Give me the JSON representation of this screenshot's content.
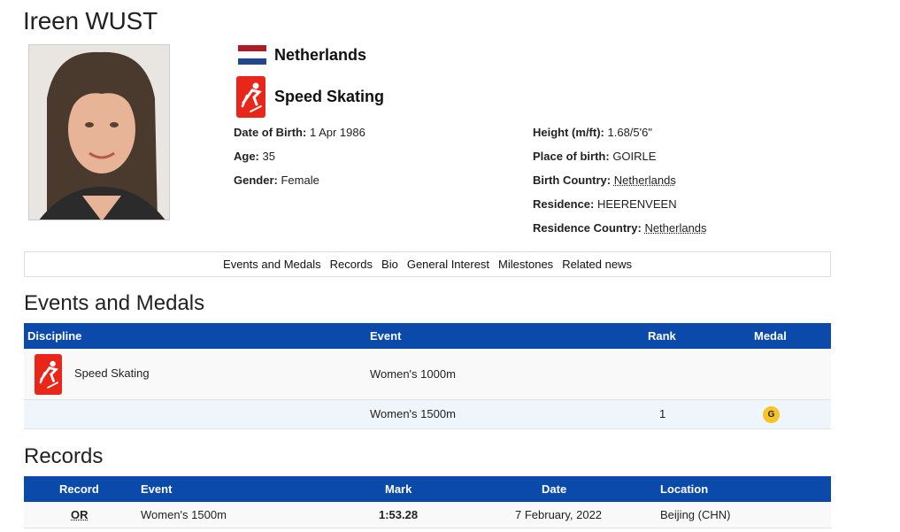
{
  "athlete": {
    "name": "Ireen WUST",
    "country": "Netherlands",
    "sport": "Speed Skating"
  },
  "flag_colors": [
    "#ae1c28",
    "#ffffff",
    "#21468b"
  ],
  "info_left": [
    {
      "label": "Date of Birth:",
      "value": "1 Apr 1986"
    },
    {
      "label": "Age:",
      "value": "35"
    },
    {
      "label": "Gender:",
      "value": "Female"
    }
  ],
  "info_right": [
    {
      "label": "Height (m/ft):",
      "value": "1.68/5'6\""
    },
    {
      "label": "Place of birth:",
      "value": "GOIRLE"
    },
    {
      "label": "Birth Country:",
      "value": "Netherlands"
    },
    {
      "label": "Residence:",
      "value": "HEERENVEEN"
    },
    {
      "label": "Residence Country:",
      "value": "Netherlands"
    }
  ],
  "nav": [
    "Events and Medals",
    "Records",
    "Bio",
    "General Interest",
    "Milestones",
    "Related news"
  ],
  "events_section": {
    "title": "Events and Medals",
    "columns": [
      "Discipline",
      "Event",
      "Rank",
      "Medal"
    ],
    "rows": [
      {
        "discipline": "Speed Skating",
        "event": "Women's 1000m",
        "rank": "",
        "medal": ""
      },
      {
        "discipline": "",
        "event": "Women's 1500m",
        "rank": "1",
        "medal": "G"
      }
    ]
  },
  "records_section": {
    "title": "Records",
    "columns": [
      "Record",
      "Event",
      "Mark",
      "Date",
      "Location"
    ],
    "rows": [
      {
        "record": "OR",
        "event": "Women's 1500m",
        "mark": "1:53.28",
        "date": "7 February, 2022",
        "location": "Beijing (CHN)"
      }
    ]
  },
  "colors": {
    "header_blue": "#0b4aab",
    "sport_red": "#e8271a",
    "gold": "#f7c325",
    "alt_row": "#eef6fb"
  },
  "icons": {
    "sport": "speed-skating-icon",
    "photo": "athlete-photo"
  }
}
